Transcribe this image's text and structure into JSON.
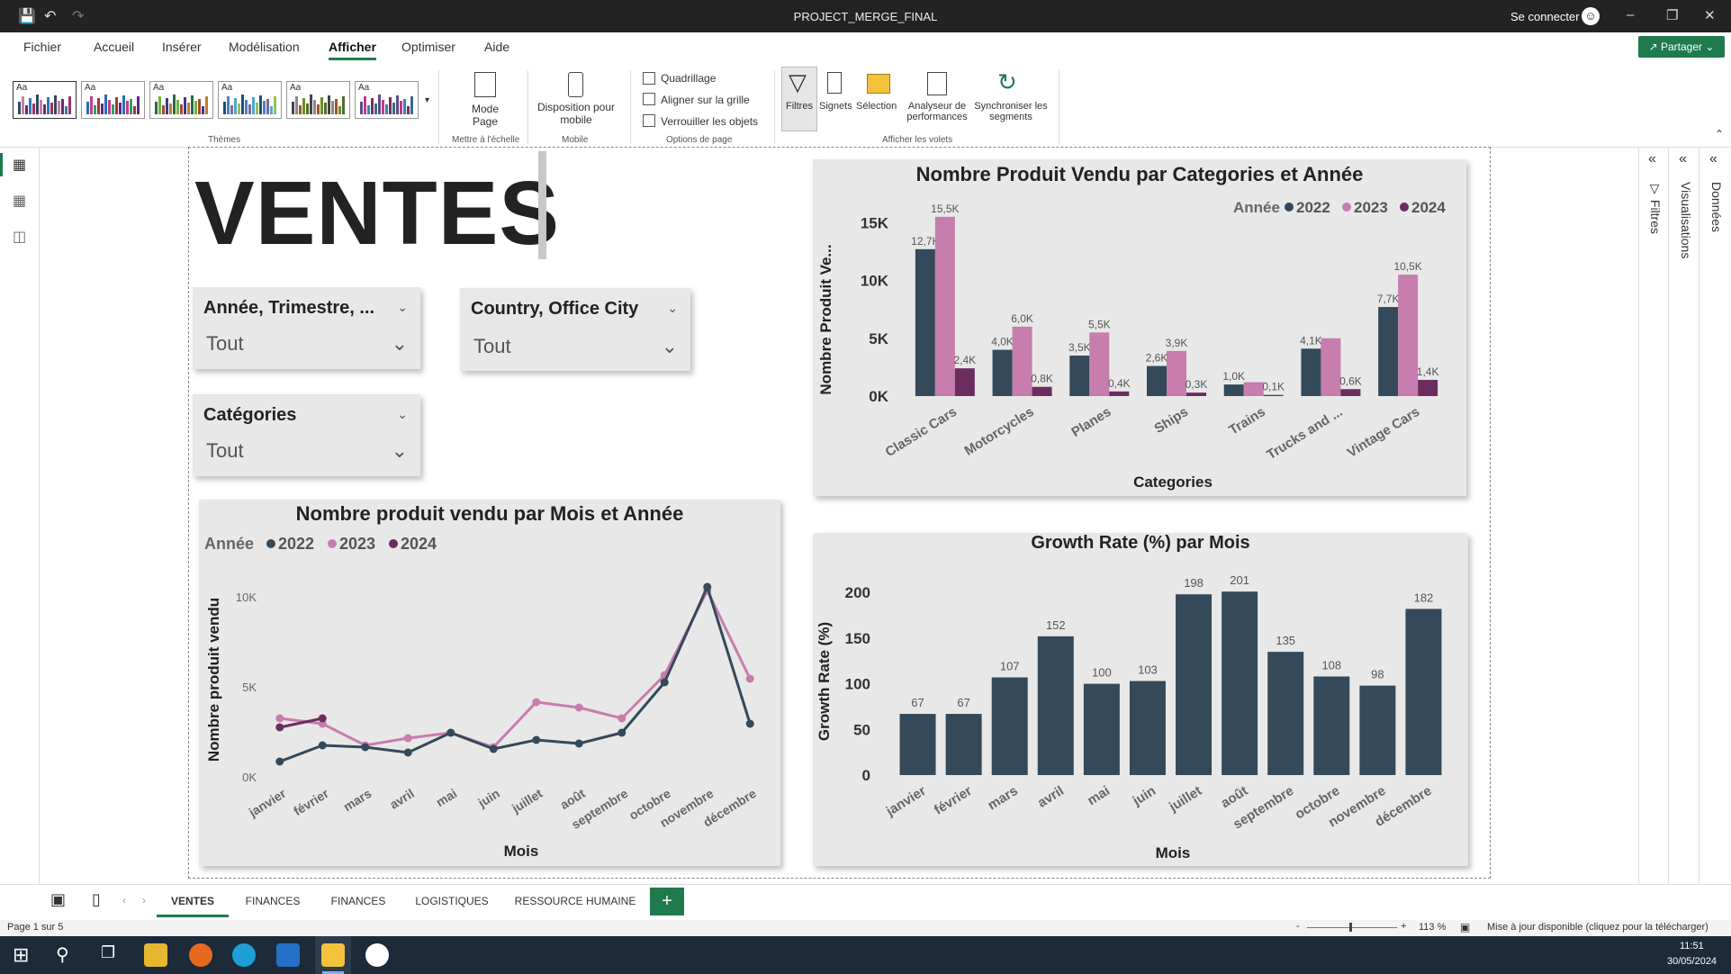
{
  "window": {
    "title": "PROJECT_MERGE_FINAL",
    "signin": "Se connecter"
  },
  "menu": {
    "items": [
      "Fichier",
      "Accueil",
      "Insérer",
      "Modélisation",
      "Afficher",
      "Optimiser",
      "Aide"
    ],
    "share": "Partager"
  },
  "ribbon": {
    "themes_label": "Thèmes",
    "theme_sample": "Aa",
    "mode_page": "Mode Page",
    "mise_echelle": "Mettre à l'échelle",
    "mobile_btn": "Disposition pour mobile",
    "mobile_label": "Mobile",
    "opt_quadrillage": "Quadrillage",
    "opt_aligner": "Aligner sur la grille",
    "opt_verrouiller": "Verrouiller les objets",
    "options_label": "Options de page",
    "filtres": "Filtres",
    "signets": "Signets",
    "selection": "Sélection",
    "analyseur": "Analyseur de performances",
    "synchroniser": "Synchroniser les segments",
    "volets_label": "Afficher les volets"
  },
  "report": {
    "title": "VENTES"
  },
  "slicers": [
    {
      "title": "Année, Trimestre, ...",
      "value": "Tout"
    },
    {
      "title": "Country, Office City",
      "value": "Tout"
    },
    {
      "title": "Catégories",
      "value": "Tout"
    }
  ],
  "panes": {
    "filtres": "Filtres",
    "visualisations": "Visualisations",
    "donnees": "Données"
  },
  "tabs": [
    "VENTES",
    "FINANCES",
    "FINANCES",
    "LOGISTIQUES",
    "RESSOURCE HUMAINE"
  ],
  "status": {
    "page": "Page 1 sur 5",
    "zoom": "113 %",
    "update": "Mise à jour disponible (cliquez pour la télécharger)",
    "minus": "-",
    "plus": "+"
  },
  "taskbar": {
    "time": "11:51",
    "date": "30/05/2024"
  },
  "colors": {
    "y2022": "#34495a",
    "y2023": "#c77dae",
    "y2024": "#6b2d5f",
    "accent": "#1f7a4d"
  },
  "chart_data": [
    {
      "type": "bar",
      "title": "Nombre Produit Vendu par Categories et Année",
      "xlabel": "Categories",
      "ylabel": "Nombre Produit Ve...",
      "legend_title": "Année",
      "legend_position": "top-right",
      "categories": [
        "Classic Cars",
        "Motorcycles",
        "Planes",
        "Ships",
        "Trains",
        "Trucks and ...",
        "Vintage Cars"
      ],
      "ylim": [
        0,
        16500
      ],
      "yticks": [
        "0K",
        "5K",
        "10K",
        "15K"
      ],
      "series": [
        {
          "name": "2022",
          "values": [
            12700,
            4000,
            3500,
            2600,
            1000,
            4100,
            7700
          ],
          "labels": [
            "12,7K",
            "4,0K",
            "3,5K",
            "2,6K",
            "1,0K",
            "4,1K",
            "7,7K"
          ]
        },
        {
          "name": "2023",
          "values": [
            15500,
            6000,
            5500,
            3900,
            1200,
            5000,
            10500
          ],
          "labels": [
            "15,5K",
            "6,0K",
            "5,5K",
            "3,9K",
            "",
            "",
            "10,5K"
          ]
        },
        {
          "name": "2024",
          "values": [
            2400,
            800,
            400,
            300,
            100,
            600,
            1400
          ],
          "labels": [
            "2,4K",
            "0,8K",
            "0,4K",
            "0,3K",
            "0,1K",
            "0,6K",
            "1,4K"
          ]
        }
      ]
    },
    {
      "type": "line",
      "title": "Nombre produit vendu par Mois et Année",
      "xlabel": "Mois",
      "ylabel": "Nombre produit vendu",
      "legend_title": "Année",
      "legend_position": "top-left",
      "categories": [
        "janvier",
        "février",
        "mars",
        "avril",
        "mai",
        "juin",
        "juillet",
        "août",
        "septembre",
        "octobre",
        "novembre",
        "décembre"
      ],
      "ylim": [
        0,
        11000
      ],
      "yticks": [
        "0K",
        "5K",
        "10K"
      ],
      "series": [
        {
          "name": "2022",
          "values": [
            900,
            1800,
            1700,
            1400,
            2500,
            1600,
            2100,
            1900,
            2500,
            5300,
            10600,
            3000
          ]
        },
        {
          "name": "2023",
          "values": [
            3300,
            3000,
            1800,
            2200,
            2500,
            1700,
            4200,
            3900,
            3300,
            5700,
            10400,
            5500
          ]
        },
        {
          "name": "2024",
          "values": [
            2800,
            3300,
            null,
            null,
            null,
            null,
            null,
            null,
            null,
            null,
            null,
            null
          ]
        }
      ]
    },
    {
      "type": "bar",
      "title": "Growth Rate (%) par Mois",
      "xlabel": "Mois",
      "ylabel": "Growth Rate (%)",
      "categories": [
        "janvier",
        "février",
        "mars",
        "avril",
        "mai",
        "juin",
        "juillet",
        "août",
        "septembre",
        "octobre",
        "novembre",
        "décembre"
      ],
      "ylim": [
        0,
        215
      ],
      "yticks": [
        "0",
        "50",
        "100",
        "150",
        "200"
      ],
      "series": [
        {
          "values": [
            67,
            67,
            107,
            152,
            100,
            103,
            198,
            201,
            135,
            108,
            98,
            182
          ]
        }
      ]
    }
  ]
}
